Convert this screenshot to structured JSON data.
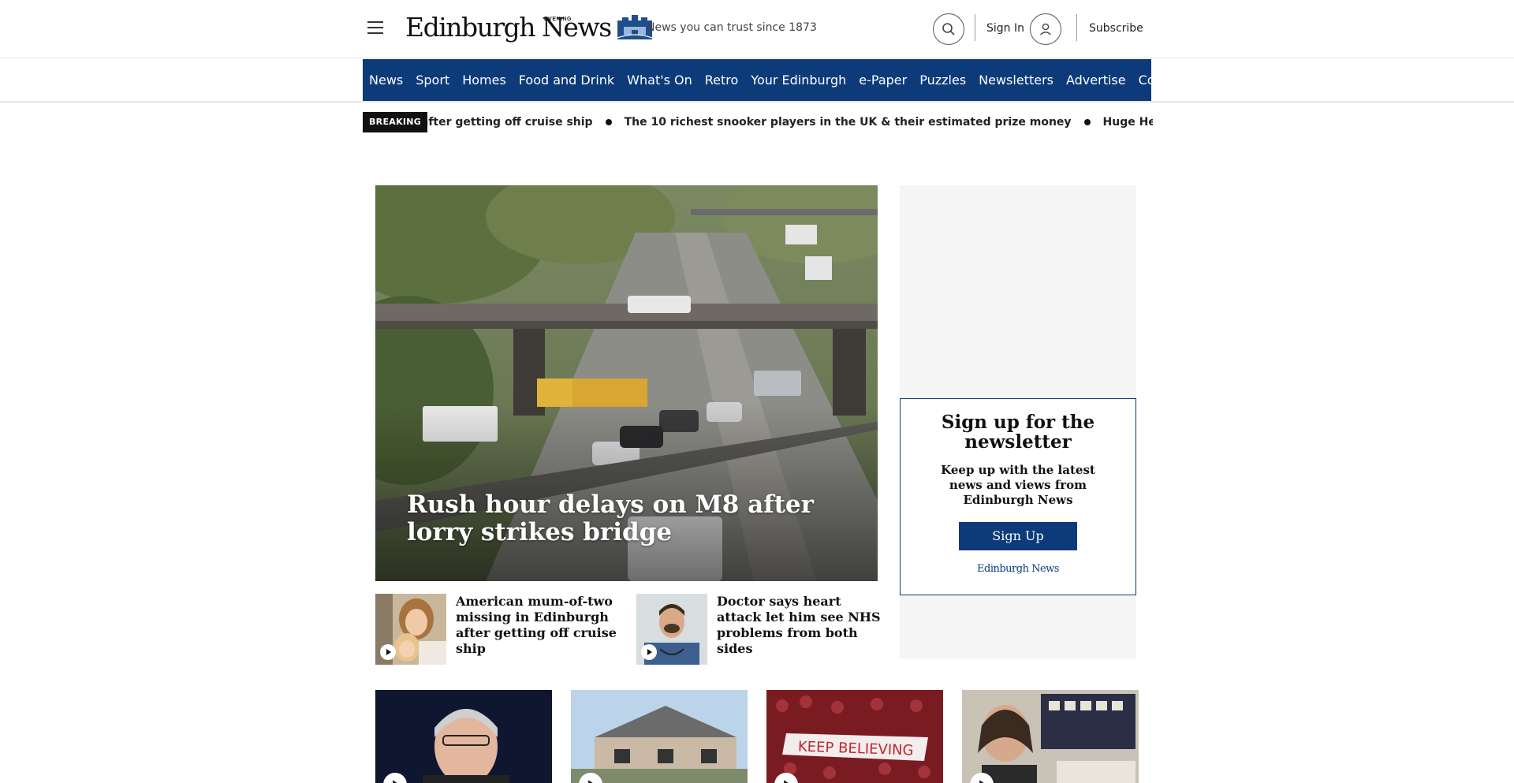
{
  "header": {
    "logo_text": "Edinburgh News",
    "logo_evening": "EVENING",
    "tagline": "News you can trust since 1873",
    "sign_in": "Sign In",
    "subscribe": "Subscribe",
    "icons": {
      "menu": "hamburger-menu-icon",
      "search": "search-icon",
      "user": "user-icon",
      "crest": "city-crest-icon"
    }
  },
  "nav": {
    "items": [
      "News",
      "Sport",
      "Homes",
      "Food and Drink",
      "What's On",
      "Retro",
      "Your Edinburgh",
      "e-Paper",
      "Puzzles",
      "Newsletters",
      "Advertise",
      "Contact"
    ]
  },
  "ticker": {
    "label": "BREAKING",
    "items": [
      "urgh after getting off cruise ship",
      "The 10 richest snooker players in the UK & their estimated prize money",
      "Huge Hearts support l"
    ]
  },
  "hero": {
    "title": "Rush hour delays on M8 after lorry strikes bridge"
  },
  "stories": [
    {
      "title": "American mum-of-two missing in Edinburgh after getting off cruise ship"
    },
    {
      "title": "Doctor says heart attack let him see NHS problems from both sides"
    }
  ],
  "newsletter": {
    "title": "Sign up for the newsletter",
    "text": "Keep up with the latest news and views from Edinburgh News",
    "button": "Sign Up",
    "logo": "Edinburgh News"
  },
  "colors": {
    "nav_bg": "#0d3b7a",
    "accent": "#0d3b7a",
    "sidebar_bg": "#f5f5f5"
  }
}
